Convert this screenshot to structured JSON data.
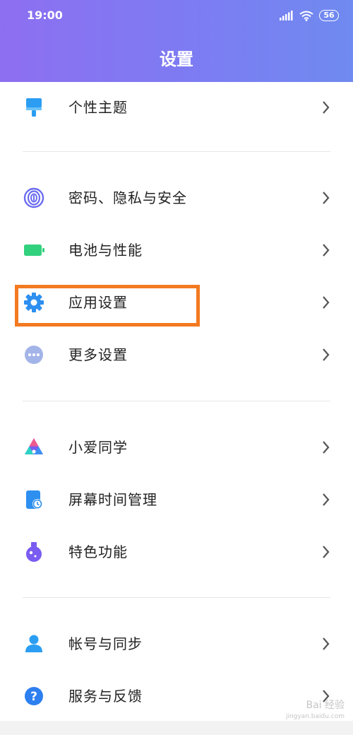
{
  "status_bar": {
    "time": "19:00",
    "battery": "56"
  },
  "header": {
    "title": "设置"
  },
  "items": [
    {
      "label": "个性主题",
      "icon": "theme-brush-icon",
      "color": "#2b9ef3"
    },
    {
      "label": "密码、隐私与安全",
      "icon": "fingerprint-icon",
      "color": "#6b6cf0"
    },
    {
      "label": "电池与性能",
      "icon": "battery-icon",
      "color": "#32d17e"
    },
    {
      "label": "应用设置",
      "icon": "gear-icon",
      "color": "#2d8ff0"
    },
    {
      "label": "更多设置",
      "icon": "more-dots-icon",
      "color": "#a3b4e8"
    },
    {
      "label": "小爱同学",
      "icon": "xiaoai-icon",
      "color": "#7a5cf0"
    },
    {
      "label": "屏幕时间管理",
      "icon": "screen-time-icon",
      "color": "#2d8ff0"
    },
    {
      "label": "特色功能",
      "icon": "flask-icon",
      "color": "#7a5cf0"
    },
    {
      "label": "帐号与同步",
      "icon": "account-icon",
      "color": "#2b9ef3"
    },
    {
      "label": "服务与反馈",
      "icon": "help-icon",
      "color": "#2d7ff0"
    }
  ],
  "highlight_color": "#f37a21",
  "watermark": {
    "text": "Bai 经验",
    "sub": "jingyan.baidu.com"
  }
}
